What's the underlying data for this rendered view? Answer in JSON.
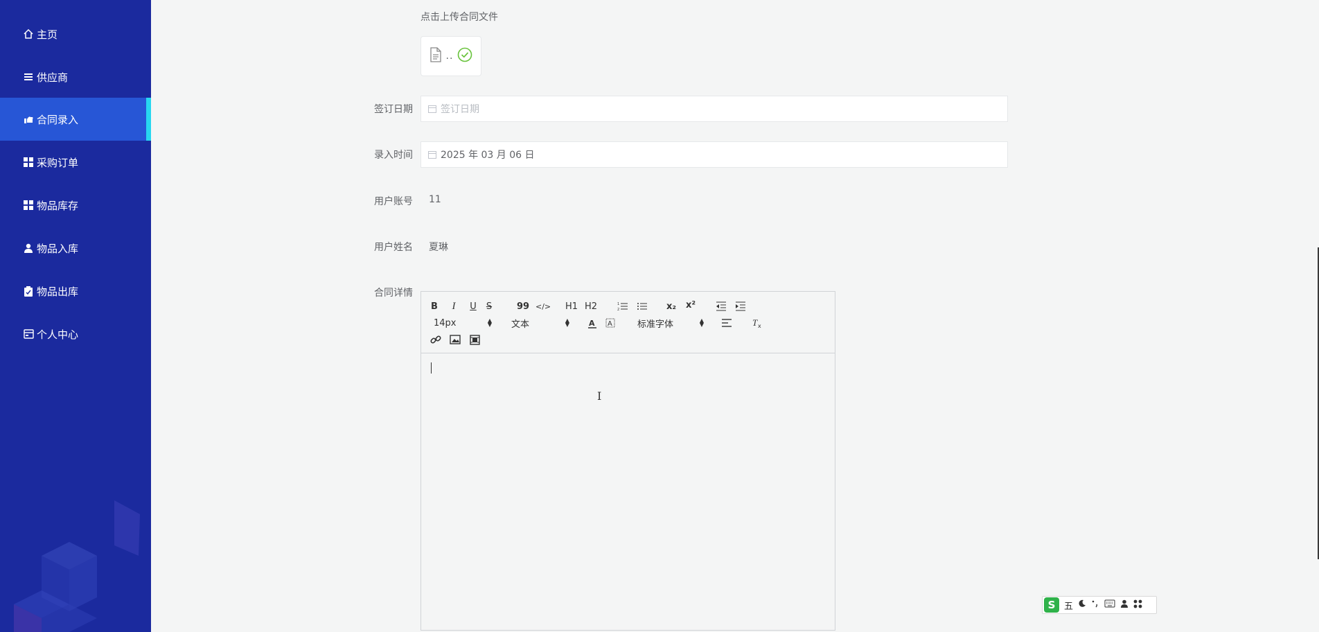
{
  "sidebar": {
    "items": [
      {
        "label": "主页",
        "icon": "home-icon"
      },
      {
        "label": "供应商",
        "icon": "list-icon"
      },
      {
        "label": "合同录入",
        "icon": "hand-icon",
        "active": true
      },
      {
        "label": "采购订单",
        "icon": "grid-icon"
      },
      {
        "label": "物品库存",
        "icon": "grid-icon"
      },
      {
        "label": "物品入库",
        "icon": "user-icon"
      },
      {
        "label": "物品出库",
        "icon": "clipboard-icon"
      },
      {
        "label": "个人中心",
        "icon": "card-icon"
      }
    ],
    "bg_color": "#1b2a9e",
    "active_color": "#2756d6",
    "active_bar_color": "#27d7f0"
  },
  "form": {
    "upload_hint": "点击上传合同文件",
    "upload_file_name": "..",
    "sign_date_label": "签订日期",
    "sign_date_placeholder": "签订日期",
    "entry_time_label": "录入时间",
    "entry_time_value": "2025 年 03 月 06 日",
    "account_label": "用户账号",
    "account_value": "11",
    "name_label": "用户姓名",
    "name_value": "夏琳",
    "detail_label": "合同详情"
  },
  "editor": {
    "buttons": {
      "bold": "B",
      "italic": "I",
      "underline": "U",
      "strike": "S",
      "quote": "99",
      "code": "</>",
      "h1": "H1",
      "h2": "H2",
      "sub": "x₂",
      "sup": "x²"
    },
    "font_size": "14px",
    "header_select": "文本",
    "font_family": "标准字体"
  },
  "ime": {
    "logo": "S",
    "mode": "五"
  }
}
